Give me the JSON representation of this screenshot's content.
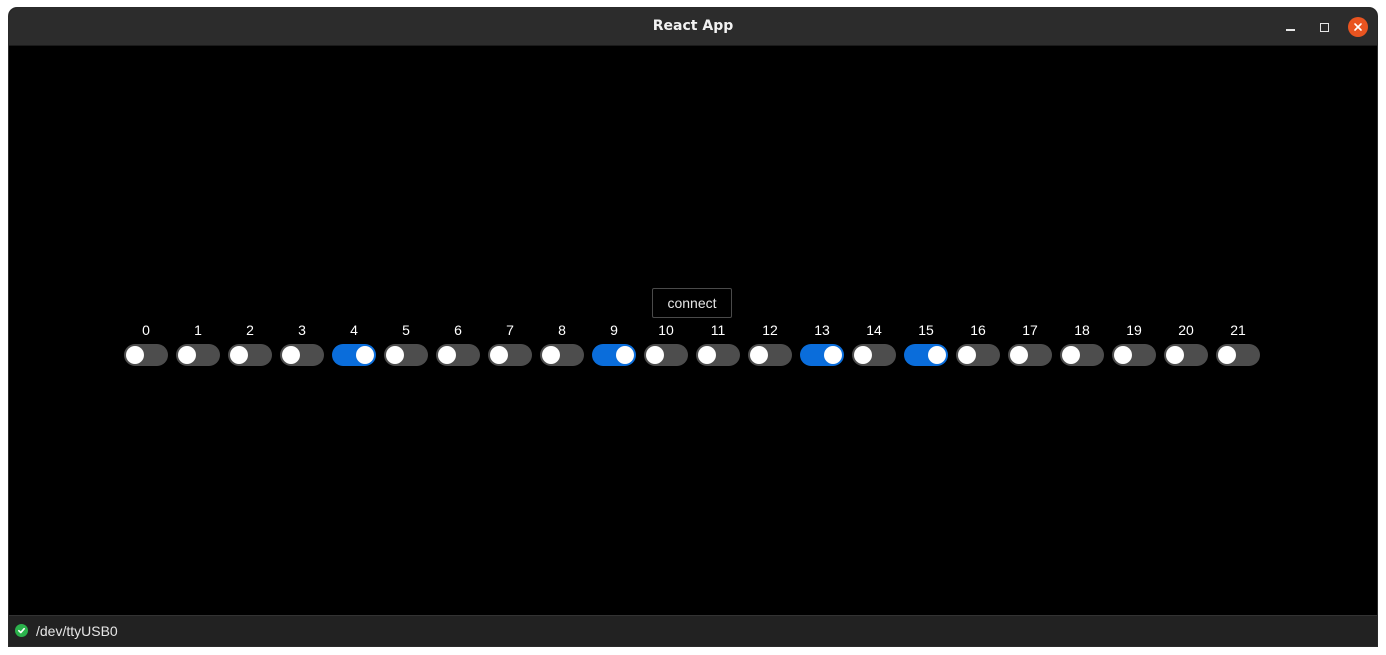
{
  "window": {
    "title": "React App"
  },
  "main": {
    "connect_label": "connect",
    "pins": [
      {
        "label": "0",
        "on": false
      },
      {
        "label": "1",
        "on": false
      },
      {
        "label": "2",
        "on": false
      },
      {
        "label": "3",
        "on": false
      },
      {
        "label": "4",
        "on": true
      },
      {
        "label": "5",
        "on": false
      },
      {
        "label": "6",
        "on": false
      },
      {
        "label": "7",
        "on": false
      },
      {
        "label": "8",
        "on": false
      },
      {
        "label": "9",
        "on": true
      },
      {
        "label": "10",
        "on": false
      },
      {
        "label": "11",
        "on": false
      },
      {
        "label": "12",
        "on": false
      },
      {
        "label": "13",
        "on": true
      },
      {
        "label": "14",
        "on": false
      },
      {
        "label": "15",
        "on": true
      },
      {
        "label": "16",
        "on": false
      },
      {
        "label": "17",
        "on": false
      },
      {
        "label": "18",
        "on": false
      },
      {
        "label": "19",
        "on": false
      },
      {
        "label": "20",
        "on": false
      },
      {
        "label": "21",
        "on": false
      }
    ]
  },
  "status": {
    "port": "/dev/ttyUSB0",
    "icon": "check-circle-icon",
    "color": "#2bb24c"
  },
  "colors": {
    "toggle_on": "#0a6ddb",
    "toggle_off": "#4d4d4d",
    "close_button": "#e95420"
  }
}
